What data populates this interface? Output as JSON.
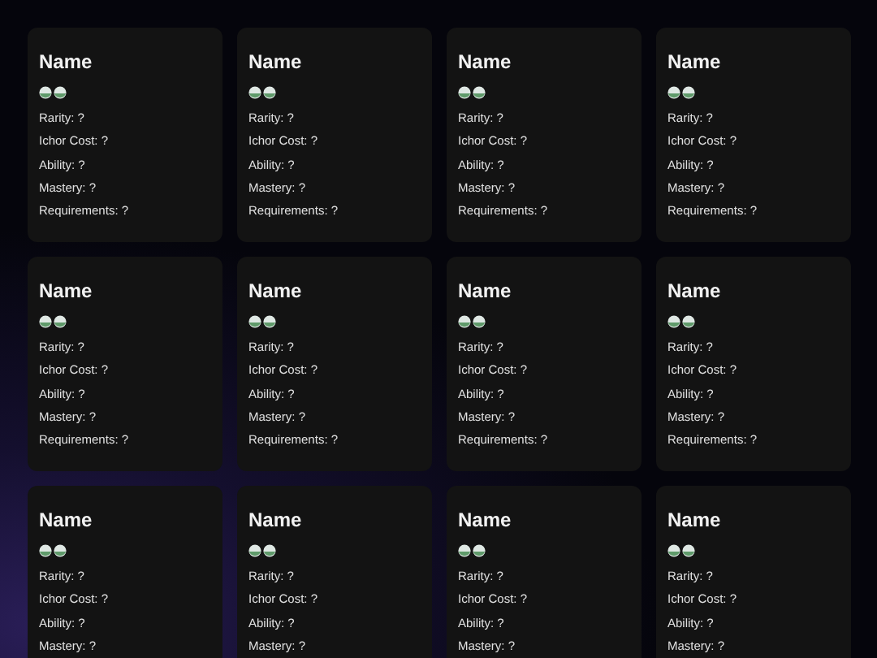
{
  "cards": [
    {
      "name": "Name",
      "icons": [
        {
          "kind": "orb"
        },
        {
          "kind": "orb"
        }
      ],
      "fields": [
        "Rarity: ?",
        "Ichor Cost: ?",
        "Ability: ?",
        "Mastery: ?",
        "Requirements: ?"
      ]
    },
    {
      "name": "Name",
      "icons": [
        {
          "kind": "orb"
        },
        {
          "kind": "orb"
        }
      ],
      "fields": [
        "Rarity: ?",
        "Ichor Cost: ?",
        "Ability: ?",
        "Mastery: ?",
        "Requirements: ?"
      ]
    },
    {
      "name": "Name",
      "icons": [
        {
          "kind": "orb"
        },
        {
          "kind": "orb"
        }
      ],
      "fields": [
        "Rarity: ?",
        "Ichor Cost: ?",
        "Ability: ?",
        "Mastery: ?",
        "Requirements: ?"
      ]
    },
    {
      "name": "Name",
      "icons": [
        {
          "kind": "orb"
        },
        {
          "kind": "orb"
        }
      ],
      "fields": [
        "Rarity: ?",
        "Ichor Cost: ?",
        "Ability: ?",
        "Mastery: ?",
        "Requirements: ?"
      ]
    },
    {
      "name": "Name",
      "icons": [
        {
          "kind": "orb"
        },
        {
          "kind": "orb"
        }
      ],
      "fields": [
        "Rarity: ?",
        "Ichor Cost: ?",
        "Ability: ?",
        "Mastery: ?",
        "Requirements: ?"
      ]
    },
    {
      "name": "Name",
      "icons": [
        {
          "kind": "orb"
        },
        {
          "kind": "orb"
        }
      ],
      "fields": [
        "Rarity: ?",
        "Ichor Cost: ?",
        "Ability: ?",
        "Mastery: ?",
        "Requirements: ?"
      ]
    },
    {
      "name": "Name",
      "icons": [
        {
          "kind": "orb"
        },
        {
          "kind": "orb"
        }
      ],
      "fields": [
        "Rarity: ?",
        "Ichor Cost: ?",
        "Ability: ?",
        "Mastery: ?",
        "Requirements: ?"
      ]
    },
    {
      "name": "Name",
      "icons": [
        {
          "kind": "orb"
        },
        {
          "kind": "orb"
        }
      ],
      "fields": [
        "Rarity: ?",
        "Ichor Cost: ?",
        "Ability: ?",
        "Mastery: ?",
        "Requirements: ?"
      ]
    },
    {
      "name": "Name",
      "icons": [
        {
          "kind": "orb"
        },
        {
          "kind": "orb"
        }
      ],
      "fields": [
        "Rarity: ?",
        "Ichor Cost: ?",
        "Ability: ?",
        "Mastery: ?"
      ]
    },
    {
      "name": "Name",
      "icons": [
        {
          "kind": "orb"
        },
        {
          "kind": "orb"
        }
      ],
      "fields": [
        "Rarity: ?",
        "Ichor Cost: ?",
        "Ability: ?",
        "Mastery: ?"
      ]
    },
    {
      "name": "Name",
      "icons": [
        {
          "kind": "orb"
        },
        {
          "kind": "orb"
        }
      ],
      "fields": [
        "Rarity: ?",
        "Ichor Cost: ?",
        "Ability: ?",
        "Mastery: ?"
      ]
    },
    {
      "name": "Name",
      "icons": [
        {
          "kind": "orb"
        },
        {
          "kind": "orb"
        }
      ],
      "fields": [
        "Rarity: ?",
        "Ichor Cost: ?",
        "Ability: ?",
        "Mastery: ?"
      ]
    }
  ]
}
